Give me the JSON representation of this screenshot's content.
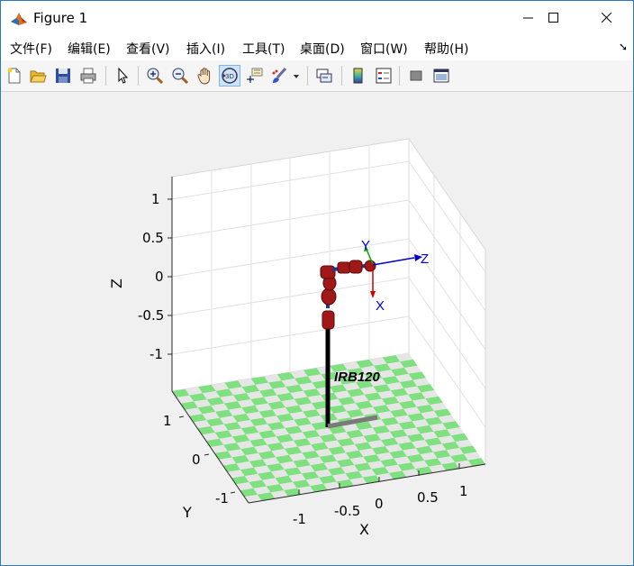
{
  "window": {
    "title": "Figure 1"
  },
  "menu": [
    "文件(F)",
    "编辑(E)",
    "查看(V)",
    "插入(I)",
    "工具(T)",
    "桌面(D)",
    "窗口(W)",
    "帮助(H)"
  ],
  "toolbar": {
    "buttons": [
      "new-figure-icon",
      "open-file-icon",
      "save-icon",
      "print-icon",
      "pointer-icon",
      "zoom-in-icon",
      "zoom-out-icon",
      "pan-hand-icon",
      "rotate-3d-icon",
      "data-cursor-icon",
      "brush-icon",
      "brush-dropdown-icon",
      "link-plot-icon",
      "colorbar-icon",
      "legend-icon",
      "hide-plot-tools-icon",
      "show-plot-tools-icon"
    ],
    "active": "rotate-3d-icon"
  },
  "plot": {
    "z_axis": {
      "label": "Z",
      "ticks": [
        "1",
        "0.5",
        "0",
        "-0.5",
        "-1"
      ]
    },
    "y_axis": {
      "label": "Y",
      "ticks": [
        "1",
        "0",
        "-1"
      ]
    },
    "x_axis": {
      "label": "X",
      "ticks": [
        "-1",
        "-0.5",
        "0",
        "0.5",
        "1"
      ]
    },
    "robot_name": "IRB120",
    "frame_labels": {
      "x": "X",
      "y": "Y",
      "z": "Z"
    },
    "colors": {
      "floor_green": "#7fe07f",
      "floor_gray": "#e6e6e6",
      "link": "#a01818",
      "frame_x": "#cc0000",
      "frame_y": "#00aa00",
      "frame_z": "#0000cc"
    }
  }
}
